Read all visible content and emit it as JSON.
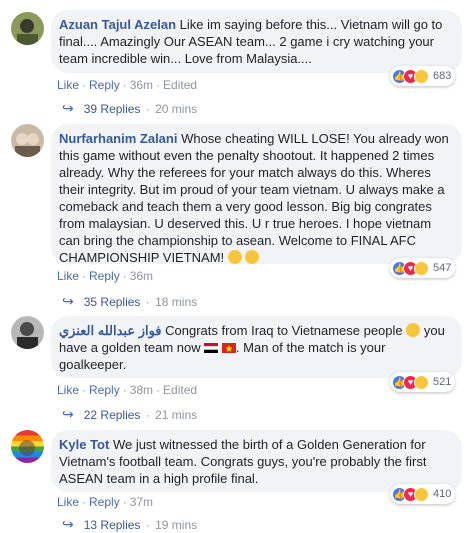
{
  "comments": [
    {
      "author": "Azuan Tajul Azelan",
      "text": " Like im saying before this... Vietnam will go to final.... Amazingly Our ASEAN team... 2 game i cry watching your team incredible win... Love from Malaysia....",
      "like": "Like",
      "reply": "Reply",
      "time": "36m",
      "edited": "Edited",
      "reactions": [
        "like-icon",
        "love-icon",
        "sad-icon"
      ],
      "count": "683",
      "replies": "39 Replies",
      "replies_time": "20 mins"
    },
    {
      "author": "Nurfarhanim Zalani",
      "text": " Whose cheating WILL LOSE! You already won this game without even the penalty shootout. It happened 2 times already. Why the referees for your match always do this. Wheres their integrity. But im proud of your team vietnam. U always make a comeback and teach them a very good lesson. Big big congrates from malaysian. U deserved this. U r true heroes. I hope vietnam can bring the championship to asean. Welcome to FINAL AFC CHAMPIONSHIP VIETNAM! ",
      "like": "Like",
      "reply": "Reply",
      "time": "36m",
      "reactions": [
        "like-icon",
        "love-icon",
        "haha-icon"
      ],
      "count": "547",
      "replies": "35 Replies",
      "replies_time": "18 mins"
    },
    {
      "author": "فواز عبدالله العنزي",
      "text_a": " Congrats from Iraq to Vietnamese people ",
      "text_b": " you have a golden team now ",
      "text_c": ". Man of the match is your goalkeeper.",
      "like": "Like",
      "reply": "Reply",
      "time": "38m",
      "edited": "Edited",
      "reactions": [
        "like-icon",
        "love-icon",
        "haha-icon"
      ],
      "count": "521",
      "replies": "22 Replies",
      "replies_time": "21 mins"
    },
    {
      "author": "Kyle Tot",
      "text": " We just witnessed the birth of a Golden Generation for Vietnam's football team. Congrats guys, you're probably the first ASEAN team in a high profile final.",
      "like": "Like",
      "reply": "Reply",
      "time": "37m",
      "reactions": [
        "like-icon",
        "love-icon",
        "haha-icon"
      ],
      "count": "410",
      "replies": "13 Replies",
      "replies_time": "19 mins"
    }
  ]
}
